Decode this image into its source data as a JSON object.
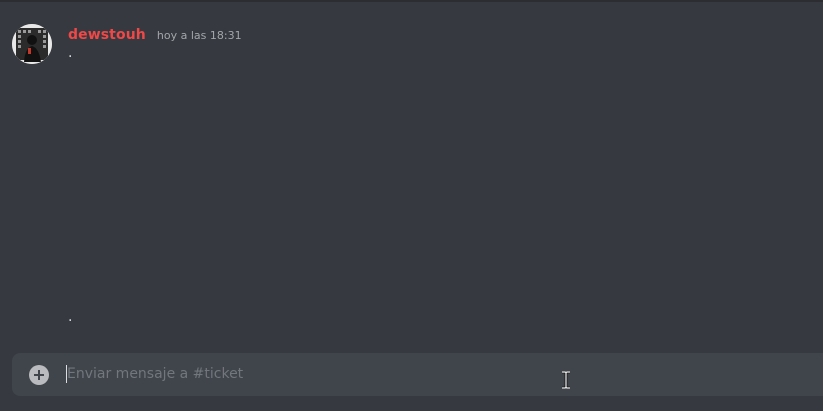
{
  "message": {
    "username": "dewstouh",
    "timestamp": "hoy a las 18:31",
    "content": ".",
    "content2": "."
  },
  "composer": {
    "placeholder": "Enviar mensaje a #ticket",
    "add_icon": "plus-circle-icon"
  },
  "colors": {
    "username": "#f04747",
    "background": "#36393f",
    "composer_bg": "#40444b",
    "timestamp": "#a3a6aa",
    "text": "#dcddde",
    "placeholder": "#72767d"
  }
}
